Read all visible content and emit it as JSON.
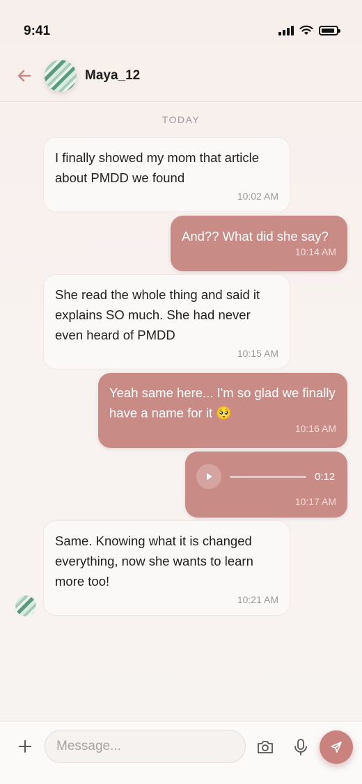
{
  "status_bar": {
    "time": "9:41"
  },
  "header": {
    "contact_name": "Maya_12"
  },
  "date_separator": "TODAY",
  "messages": [
    {
      "direction": "in",
      "text": "I finally showed my mom that article about PMDD we found",
      "time": "10:02 AM"
    },
    {
      "direction": "out",
      "text": "And?? What did she say?",
      "time": "10:14 AM"
    },
    {
      "direction": "in",
      "text": "She read the whole thing and said it explains SO much. She had never even heard of PMDD",
      "time": "10:15 AM"
    },
    {
      "direction": "out",
      "text": "Yeah same here... I'm so glad we finally have a name for it 🥺",
      "time": "10:16 AM"
    },
    {
      "direction": "out",
      "type": "voice",
      "duration": "0:12",
      "time": "10:17 AM"
    },
    {
      "direction": "in",
      "text": "Same. Knowing what it is changed everything, now she wants to learn more too!",
      "time": "10:21 AM"
    }
  ],
  "input": {
    "placeholder": "Message..."
  },
  "icons": [
    "back-arrow-icon",
    "plus-icon",
    "camera-icon",
    "microphone-icon",
    "send-icon",
    "play-icon"
  ],
  "colors": {
    "accent": "#c98b86",
    "send_button": "#c9827d",
    "incoming_bubble": "#fbf9f8",
    "back_arrow": "#c98b86"
  }
}
